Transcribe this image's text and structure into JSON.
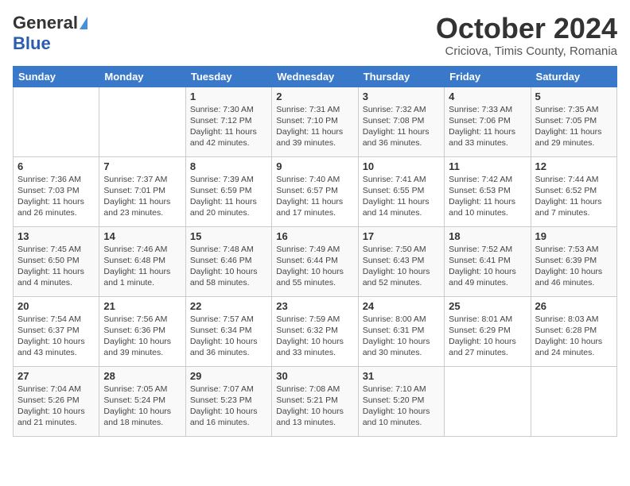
{
  "header": {
    "logo_general": "General",
    "logo_blue": "Blue",
    "month": "October 2024",
    "location": "Criciova, Timis County, Romania"
  },
  "days_of_week": [
    "Sunday",
    "Monday",
    "Tuesday",
    "Wednesday",
    "Thursday",
    "Friday",
    "Saturday"
  ],
  "weeks": [
    [
      {
        "day": "",
        "detail": ""
      },
      {
        "day": "",
        "detail": ""
      },
      {
        "day": "1",
        "detail": "Sunrise: 7:30 AM\nSunset: 7:12 PM\nDaylight: 11 hours and 42 minutes."
      },
      {
        "day": "2",
        "detail": "Sunrise: 7:31 AM\nSunset: 7:10 PM\nDaylight: 11 hours and 39 minutes."
      },
      {
        "day": "3",
        "detail": "Sunrise: 7:32 AM\nSunset: 7:08 PM\nDaylight: 11 hours and 36 minutes."
      },
      {
        "day": "4",
        "detail": "Sunrise: 7:33 AM\nSunset: 7:06 PM\nDaylight: 11 hours and 33 minutes."
      },
      {
        "day": "5",
        "detail": "Sunrise: 7:35 AM\nSunset: 7:05 PM\nDaylight: 11 hours and 29 minutes."
      }
    ],
    [
      {
        "day": "6",
        "detail": "Sunrise: 7:36 AM\nSunset: 7:03 PM\nDaylight: 11 hours and 26 minutes."
      },
      {
        "day": "7",
        "detail": "Sunrise: 7:37 AM\nSunset: 7:01 PM\nDaylight: 11 hours and 23 minutes."
      },
      {
        "day": "8",
        "detail": "Sunrise: 7:39 AM\nSunset: 6:59 PM\nDaylight: 11 hours and 20 minutes."
      },
      {
        "day": "9",
        "detail": "Sunrise: 7:40 AM\nSunset: 6:57 PM\nDaylight: 11 hours and 17 minutes."
      },
      {
        "day": "10",
        "detail": "Sunrise: 7:41 AM\nSunset: 6:55 PM\nDaylight: 11 hours and 14 minutes."
      },
      {
        "day": "11",
        "detail": "Sunrise: 7:42 AM\nSunset: 6:53 PM\nDaylight: 11 hours and 10 minutes."
      },
      {
        "day": "12",
        "detail": "Sunrise: 7:44 AM\nSunset: 6:52 PM\nDaylight: 11 hours and 7 minutes."
      }
    ],
    [
      {
        "day": "13",
        "detail": "Sunrise: 7:45 AM\nSunset: 6:50 PM\nDaylight: 11 hours and 4 minutes."
      },
      {
        "day": "14",
        "detail": "Sunrise: 7:46 AM\nSunset: 6:48 PM\nDaylight: 11 hours and 1 minute."
      },
      {
        "day": "15",
        "detail": "Sunrise: 7:48 AM\nSunset: 6:46 PM\nDaylight: 10 hours and 58 minutes."
      },
      {
        "day": "16",
        "detail": "Sunrise: 7:49 AM\nSunset: 6:44 PM\nDaylight: 10 hours and 55 minutes."
      },
      {
        "day": "17",
        "detail": "Sunrise: 7:50 AM\nSunset: 6:43 PM\nDaylight: 10 hours and 52 minutes."
      },
      {
        "day": "18",
        "detail": "Sunrise: 7:52 AM\nSunset: 6:41 PM\nDaylight: 10 hours and 49 minutes."
      },
      {
        "day": "19",
        "detail": "Sunrise: 7:53 AM\nSunset: 6:39 PM\nDaylight: 10 hours and 46 minutes."
      }
    ],
    [
      {
        "day": "20",
        "detail": "Sunrise: 7:54 AM\nSunset: 6:37 PM\nDaylight: 10 hours and 43 minutes."
      },
      {
        "day": "21",
        "detail": "Sunrise: 7:56 AM\nSunset: 6:36 PM\nDaylight: 10 hours and 39 minutes."
      },
      {
        "day": "22",
        "detail": "Sunrise: 7:57 AM\nSunset: 6:34 PM\nDaylight: 10 hours and 36 minutes."
      },
      {
        "day": "23",
        "detail": "Sunrise: 7:59 AM\nSunset: 6:32 PM\nDaylight: 10 hours and 33 minutes."
      },
      {
        "day": "24",
        "detail": "Sunrise: 8:00 AM\nSunset: 6:31 PM\nDaylight: 10 hours and 30 minutes."
      },
      {
        "day": "25",
        "detail": "Sunrise: 8:01 AM\nSunset: 6:29 PM\nDaylight: 10 hours and 27 minutes."
      },
      {
        "day": "26",
        "detail": "Sunrise: 8:03 AM\nSunset: 6:28 PM\nDaylight: 10 hours and 24 minutes."
      }
    ],
    [
      {
        "day": "27",
        "detail": "Sunrise: 7:04 AM\nSunset: 5:26 PM\nDaylight: 10 hours and 21 minutes."
      },
      {
        "day": "28",
        "detail": "Sunrise: 7:05 AM\nSunset: 5:24 PM\nDaylight: 10 hours and 18 minutes."
      },
      {
        "day": "29",
        "detail": "Sunrise: 7:07 AM\nSunset: 5:23 PM\nDaylight: 10 hours and 16 minutes."
      },
      {
        "day": "30",
        "detail": "Sunrise: 7:08 AM\nSunset: 5:21 PM\nDaylight: 10 hours and 13 minutes."
      },
      {
        "day": "31",
        "detail": "Sunrise: 7:10 AM\nSunset: 5:20 PM\nDaylight: 10 hours and 10 minutes."
      },
      {
        "day": "",
        "detail": ""
      },
      {
        "day": "",
        "detail": ""
      }
    ]
  ]
}
